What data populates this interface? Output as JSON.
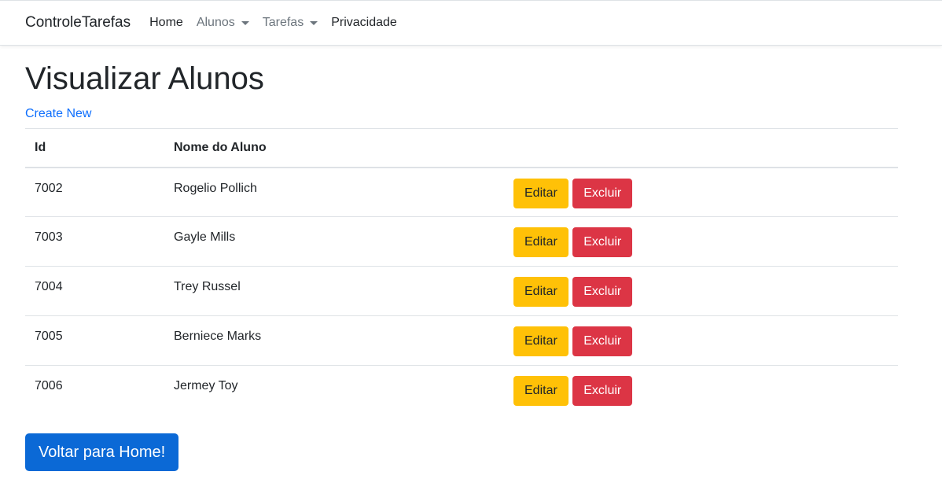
{
  "navbar": {
    "brand": "ControleTarefas",
    "items": [
      {
        "label": "Home"
      },
      {
        "label": "Alunos"
      },
      {
        "label": "Tarefas"
      },
      {
        "label": "Privacidade"
      }
    ]
  },
  "page": {
    "title": "Visualizar Alunos",
    "create_link": "Create New"
  },
  "table": {
    "headers": [
      "Id",
      "Nome do Aluno",
      ""
    ],
    "rows": [
      {
        "id": "7002",
        "name": "Rogelio Pollich",
        "edit": "Editar",
        "delete": "Excluir"
      },
      {
        "id": "7003",
        "name": "Gayle Mills",
        "edit": "Editar",
        "delete": "Excluir"
      },
      {
        "id": "7004",
        "name": "Trey Russel",
        "edit": "Editar",
        "delete": "Excluir"
      },
      {
        "id": "7005",
        "name": "Berniece Marks",
        "edit": "Editar",
        "delete": "Excluir"
      },
      {
        "id": "7006",
        "name": "Jermey Toy",
        "edit": "Editar",
        "delete": "Excluir"
      }
    ]
  },
  "footer": {
    "back_button": "Voltar para Home!"
  },
  "colors": {
    "primary": "#0b69d6",
    "warning": "#ffc107",
    "danger": "#dc3545",
    "link": "#0d6efd"
  }
}
